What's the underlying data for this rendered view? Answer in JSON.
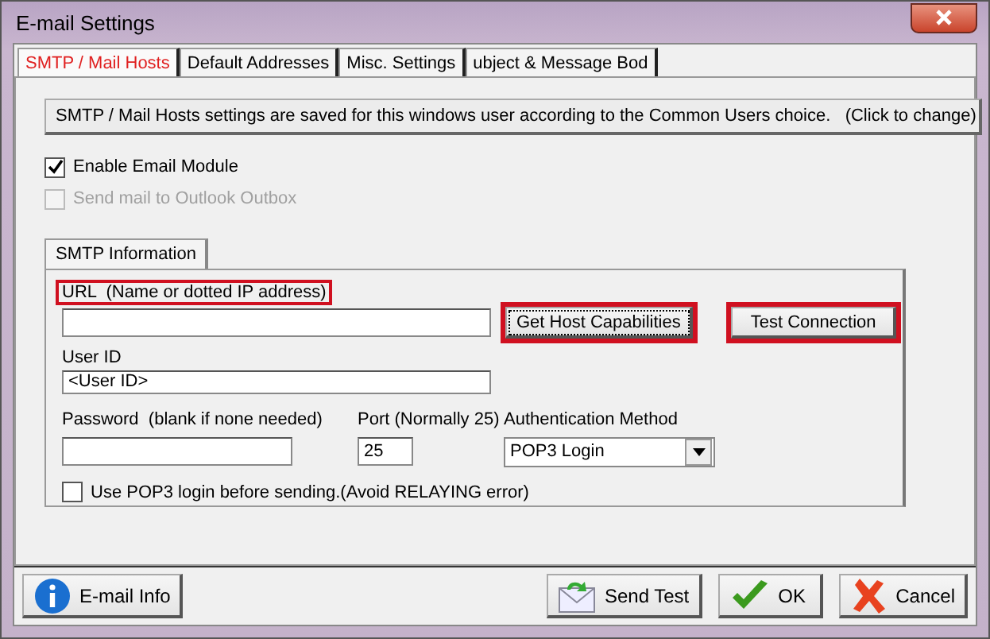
{
  "window": {
    "title": "E-mail Settings"
  },
  "tabs": [
    {
      "label": "SMTP / Mail Hosts",
      "selected": true
    },
    {
      "label": "Default Addresses",
      "selected": false
    },
    {
      "label": "Misc. Settings",
      "selected": false
    },
    {
      "label": "ubject & Message Bod",
      "selected": false
    }
  ],
  "banner": "SMTP / Mail Hosts settings are saved for this windows user according to the Common Users choice.   (Click to change)",
  "options": [
    {
      "label": "Enable Email Module",
      "checked": true,
      "disabled": false
    },
    {
      "label": "Send mail to Outlook Outbox",
      "checked": false,
      "disabled": true
    }
  ],
  "group": {
    "tab": "SMTP Information",
    "url": {
      "label": "URL  (Name or dotted IP address)",
      "highlighted": true
    },
    "buttons": [
      {
        "label": "Get Host Capabilities",
        "highlighted": true,
        "focused": true
      },
      {
        "label": "Test Connection",
        "highlighted": true,
        "focused": false
      }
    ],
    "user_id": {
      "label": "User ID",
      "value": "<User ID>"
    },
    "password": {
      "label": "Password  (blank if none needed)"
    },
    "port": {
      "label": "Port (Normally 25)",
      "value": "25"
    },
    "auth": {
      "label": "Authentication Method",
      "value": "POP3 Login"
    },
    "pop3": {
      "label": "Use POP3 login before sending.(Avoid RELAYING error)",
      "checked": false
    }
  },
  "footer": [
    {
      "kind": "info",
      "label": "E-mail Info"
    },
    {
      "kind": "send",
      "label": "Send Test"
    },
    {
      "kind": "ok",
      "label": "OK"
    },
    {
      "kind": "cancel",
      "label": "Cancel"
    }
  ]
}
